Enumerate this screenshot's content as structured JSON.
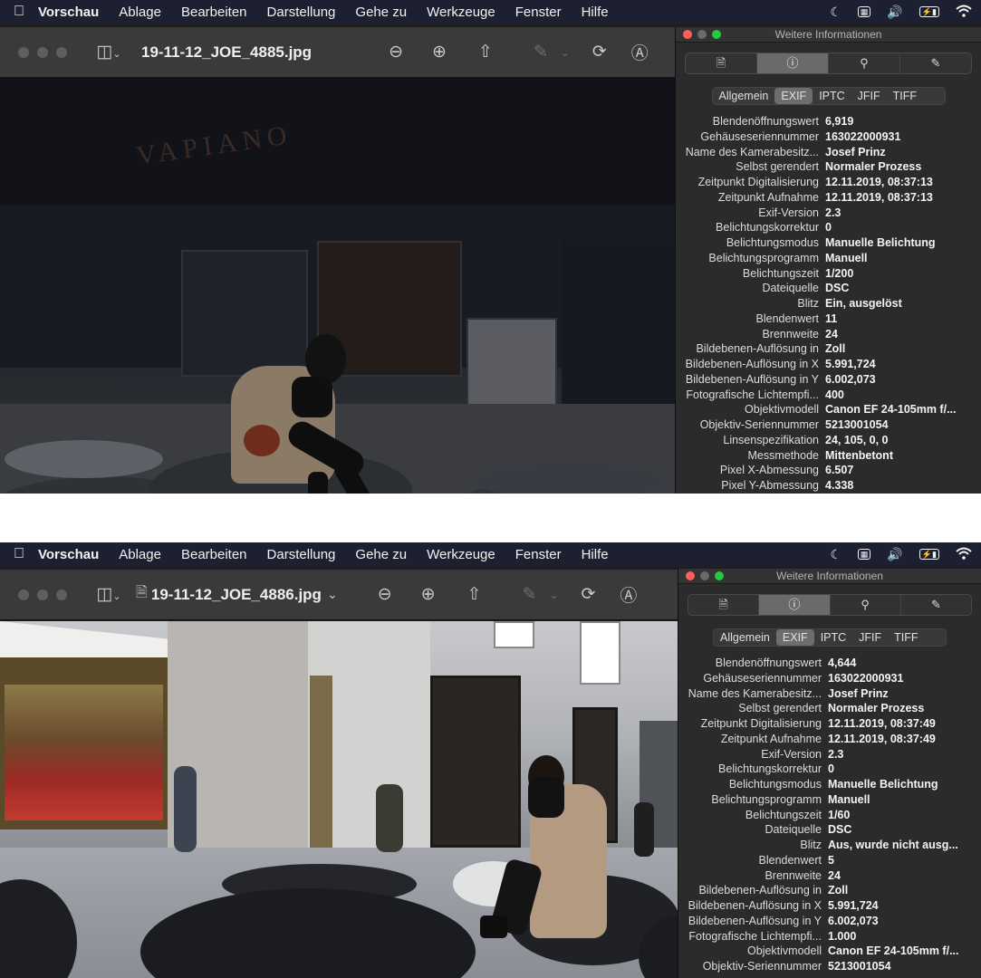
{
  "menubar": {
    "app_name": "Vorschau",
    "items": [
      "Ablage",
      "Bearbeiten",
      "Darstellung",
      "Gehe zu",
      "Werkzeuge",
      "Fenster",
      "Hilfe"
    ]
  },
  "windows": [
    {
      "filename": "19-11-12_JOE_4885.jpg",
      "panel": {
        "title": "Weitere Informationen",
        "tabs": [
          "Allgemein",
          "EXIF",
          "IPTC",
          "JFIF",
          "TIFF"
        ],
        "active_tab": "EXIF",
        "rows": [
          {
            "key": "Blendenöffnungswert",
            "value": "6,919"
          },
          {
            "key": "Gehäuseseriennummer",
            "value": "163022000931"
          },
          {
            "key": "Name des Kamerabesitz...",
            "value": "Josef Prinz"
          },
          {
            "key": "Selbst gerendert",
            "value": "Normaler Prozess"
          },
          {
            "key": "Zeitpunkt Digitalisierung",
            "value": "12.11.2019, 08:37:13"
          },
          {
            "key": "Zeitpunkt Aufnahme",
            "value": "12.11.2019, 08:37:13"
          },
          {
            "key": "Exif-Version",
            "value": "2.3"
          },
          {
            "key": "Belichtungskorrektur",
            "value": "0"
          },
          {
            "key": "Belichtungsmodus",
            "value": "Manuelle Belichtung"
          },
          {
            "key": "Belichtungsprogramm",
            "value": "Manuell"
          },
          {
            "key": "Belichtungszeit",
            "value": "1/200"
          },
          {
            "key": "Dateiquelle",
            "value": "DSC"
          },
          {
            "key": "Blitz",
            "value": "Ein, ausgelöst"
          },
          {
            "key": "Blendenwert",
            "value": "11"
          },
          {
            "key": "Brennweite",
            "value": "24"
          },
          {
            "key": "Bildebenen-Auflösung in",
            "value": "Zoll"
          },
          {
            "key": "Bildebenen-Auflösung in X",
            "value": "5.991,724"
          },
          {
            "key": "Bildebenen-Auflösung in Y",
            "value": "6.002,073"
          },
          {
            "key": "Fotografische Lichtempfi...",
            "value": "400"
          },
          {
            "key": "Objektivmodell",
            "value": "Canon EF 24-105mm f/..."
          },
          {
            "key": "Objektiv-Seriennummer",
            "value": "5213001054"
          },
          {
            "key": "Linsenspezifikation",
            "value": "24, 105, 0, 0"
          },
          {
            "key": "Messmethode",
            "value": "Mittenbetont"
          },
          {
            "key": "Pixel X-Abmessung",
            "value": "6.507"
          },
          {
            "key": "Pixel Y-Abmessung",
            "value": "4.338"
          }
        ]
      }
    },
    {
      "filename": "19-11-12_JOE_4886.jpg",
      "panel": {
        "title": "Weitere Informationen",
        "tabs": [
          "Allgemein",
          "EXIF",
          "IPTC",
          "JFIF",
          "TIFF"
        ],
        "active_tab": "EXIF",
        "rows": [
          {
            "key": "Blendenöffnungswert",
            "value": "4,644"
          },
          {
            "key": "Gehäuseseriennummer",
            "value": "163022000931"
          },
          {
            "key": "Name des Kamerabesitz...",
            "value": "Josef Prinz"
          },
          {
            "key": "Selbst gerendert",
            "value": "Normaler Prozess"
          },
          {
            "key": "Zeitpunkt Digitalisierung",
            "value": "12.11.2019, 08:37:49"
          },
          {
            "key": "Zeitpunkt Aufnahme",
            "value": "12.11.2019, 08:37:49"
          },
          {
            "key": "Exif-Version",
            "value": "2.3"
          },
          {
            "key": "Belichtungskorrektur",
            "value": "0"
          },
          {
            "key": "Belichtungsmodus",
            "value": "Manuelle Belichtung"
          },
          {
            "key": "Belichtungsprogramm",
            "value": "Manuell"
          },
          {
            "key": "Belichtungszeit",
            "value": "1/60"
          },
          {
            "key": "Dateiquelle",
            "value": "DSC"
          },
          {
            "key": "Blitz",
            "value": "Aus, wurde nicht ausg..."
          },
          {
            "key": "Blendenwert",
            "value": "5"
          },
          {
            "key": "Brennweite",
            "value": "24"
          },
          {
            "key": "Bildebenen-Auflösung in",
            "value": "Zoll"
          },
          {
            "key": "Bildebenen-Auflösung in X",
            "value": "5.991,724"
          },
          {
            "key": "Bildebenen-Auflösung in Y",
            "value": "6.002,073"
          },
          {
            "key": "Fotografische Lichtempfi...",
            "value": "1.000"
          },
          {
            "key": "Objektivmodell",
            "value": "Canon EF 24-105mm f/..."
          },
          {
            "key": "Objektiv-Seriennummer",
            "value": "5213001054"
          }
        ]
      }
    }
  ],
  "photo_text": {
    "sign": "VAPIANO"
  },
  "colors": {
    "menubar_bg": "#1d2030",
    "toolbar_bg": "#3a3a3a",
    "panel_bg": "#2b2b2b",
    "close": "#ff5f57",
    "minimize": "#febc2e",
    "zoom": "#28c840"
  }
}
